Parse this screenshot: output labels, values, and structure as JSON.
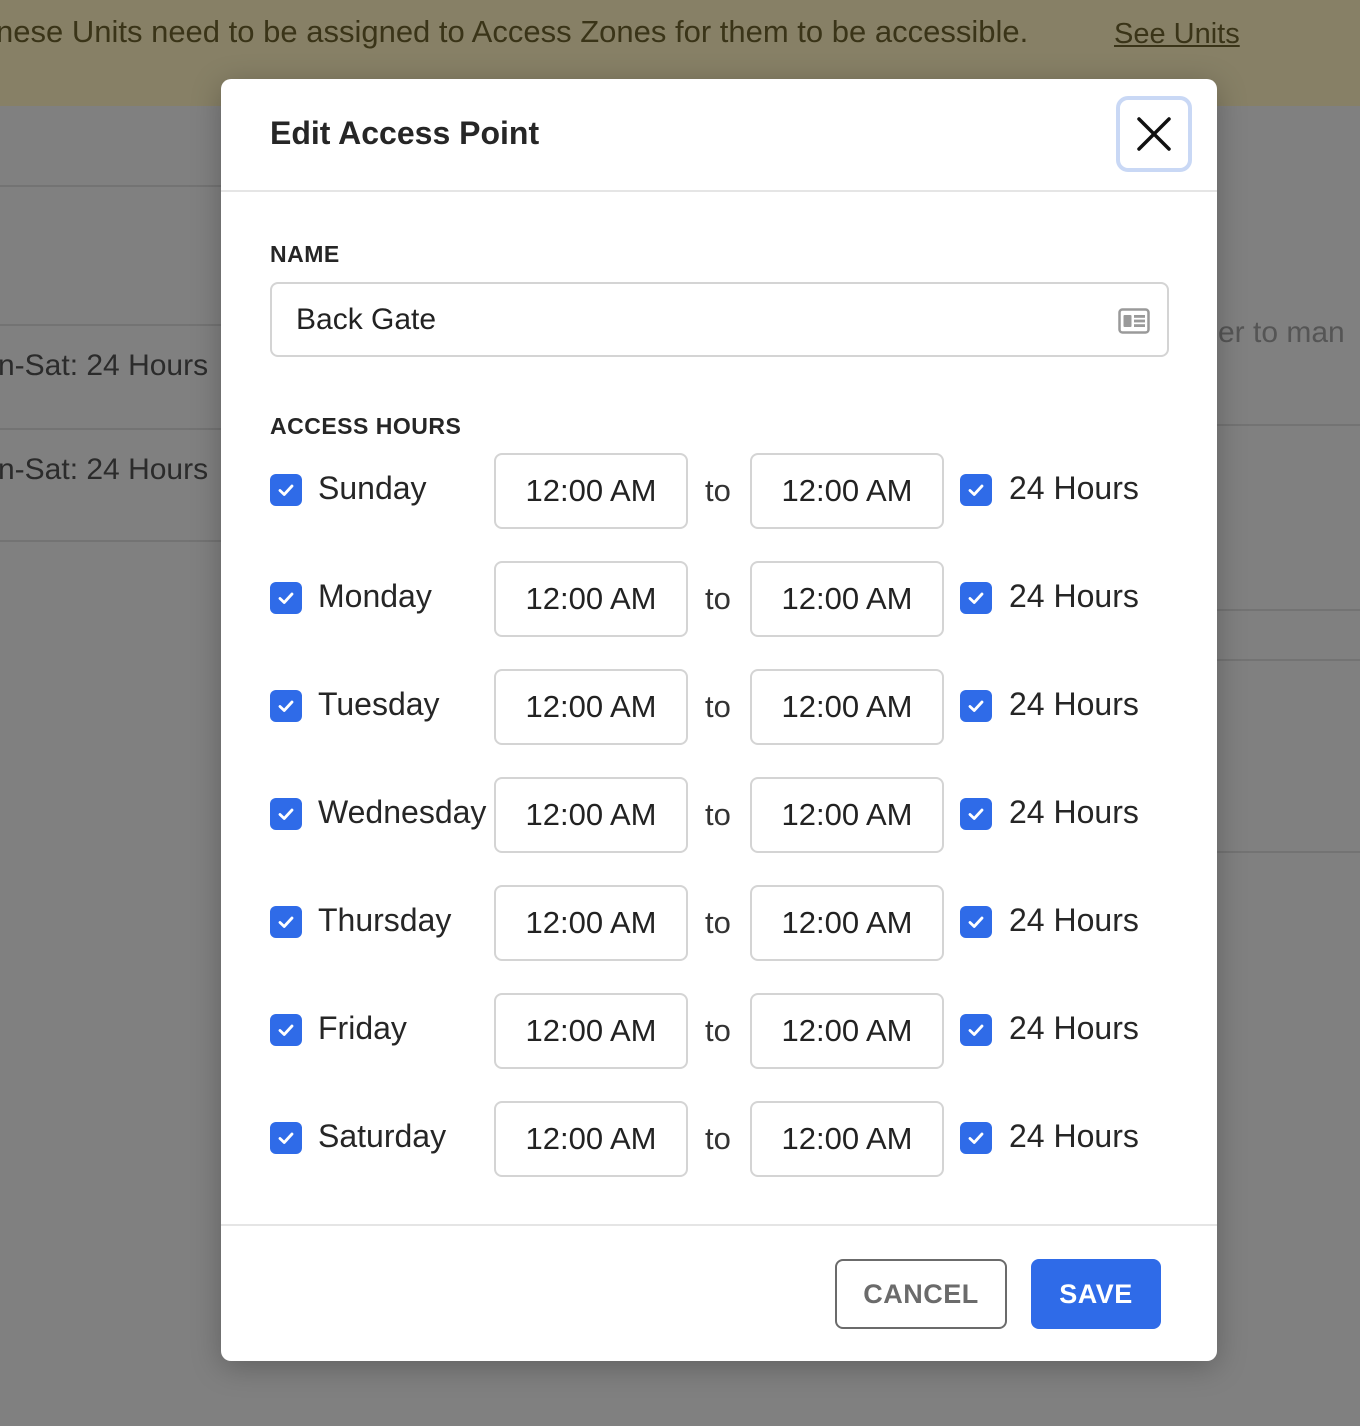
{
  "banner": {
    "text": "nese Units need to be assigned to Access Zones for them to be accessible.",
    "link": "See Units"
  },
  "background": {
    "row1_hours": "n-Sat: 24 Hours",
    "row2_hours": "n-Sat: 24 Hours",
    "right_text": "er to man"
  },
  "modal": {
    "title": "Edit Access Point",
    "name_label": "NAME",
    "name_value": "Back Gate",
    "hours_label": "ACCESS HOURS",
    "to_label": "to",
    "all_day_label": "24 Hours",
    "days": [
      {
        "name": "Sunday",
        "checked": true,
        "from": "12:00 AM",
        "to": "12:00 AM",
        "all_day": true
      },
      {
        "name": "Monday",
        "checked": true,
        "from": "12:00 AM",
        "to": "12:00 AM",
        "all_day": true
      },
      {
        "name": "Tuesday",
        "checked": true,
        "from": "12:00 AM",
        "to": "12:00 AM",
        "all_day": true
      },
      {
        "name": "Wednesday",
        "checked": true,
        "from": "12:00 AM",
        "to": "12:00 AM",
        "all_day": true
      },
      {
        "name": "Thursday",
        "checked": true,
        "from": "12:00 AM",
        "to": "12:00 AM",
        "all_day": true
      },
      {
        "name": "Friday",
        "checked": true,
        "from": "12:00 AM",
        "to": "12:00 AM",
        "all_day": true
      },
      {
        "name": "Saturday",
        "checked": true,
        "from": "12:00 AM",
        "to": "12:00 AM",
        "all_day": true
      }
    ],
    "cancel_label": "CANCEL",
    "save_label": "SAVE"
  },
  "colors": {
    "accent": "#2f6be8",
    "overlay": "#808080",
    "banner": "#878066"
  },
  "icons": {
    "close": "close-icon",
    "checkbox": "checkmark-icon",
    "name_field": "contact-card-icon"
  }
}
